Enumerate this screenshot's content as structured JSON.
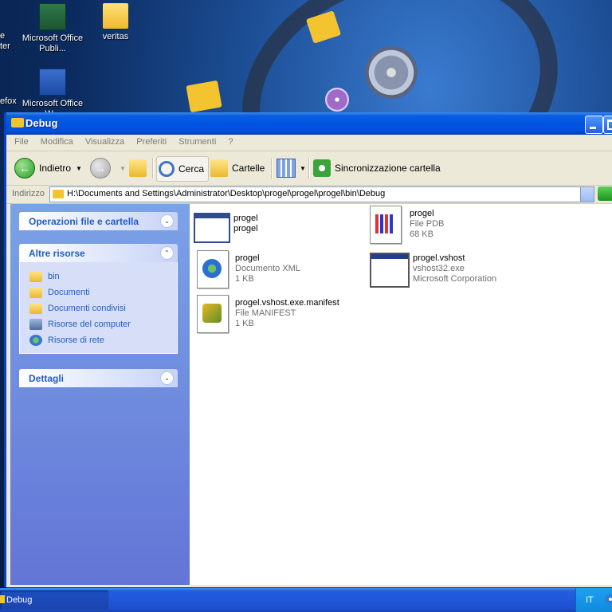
{
  "desktop": {
    "icons": [
      {
        "name": "publisher-shortcut",
        "label": "Microsoft Office Publi..."
      },
      {
        "name": "veritas-folder",
        "label": "veritas"
      },
      {
        "name": "word-shortcut",
        "label": "Microsoft Office W..."
      }
    ],
    "edge_labels": [
      "e",
      "ter",
      "efox"
    ]
  },
  "window": {
    "title": "Debug",
    "menu": [
      "File",
      "Modifica",
      "Visualizza",
      "Preferiti",
      "Strumenti",
      "?"
    ],
    "toolbar": {
      "back": "Indietro",
      "search": "Cerca",
      "folders": "Cartelle",
      "sync": "Sincronizzazione cartella"
    },
    "address": {
      "label": "Indirizzo",
      "path": "H:\\Documents and Settings\\Administrator\\Desktop\\progel\\progel\\progel\\bin\\Debug"
    },
    "taskpane": {
      "panel1": {
        "title": "Operazioni file e cartella"
      },
      "panel2": {
        "title": "Altre risorse",
        "items": [
          {
            "label": "bin",
            "icon": "folder-icon"
          },
          {
            "label": "Documenti",
            "icon": "folder-icon"
          },
          {
            "label": "Documenti condivisi",
            "icon": "folder-icon"
          },
          {
            "label": "Risorse del computer",
            "icon": "computer-icon"
          },
          {
            "label": "Risorse di rete",
            "icon": "network-icon"
          }
        ]
      },
      "panel3": {
        "title": "Dettagli"
      }
    },
    "files": [
      {
        "name": "progel",
        "line2": "progel",
        "line3": ""
      },
      {
        "name": "progel",
        "line2": "File PDB",
        "line3": "68 KB"
      },
      {
        "name": "progel",
        "line2": "Documento XML",
        "line3": "1 KB"
      },
      {
        "name": "progel.vshost",
        "line2": "vshost32.exe",
        "line3": "Microsoft Corporation"
      },
      {
        "name": "progel.vshost.exe.manifest",
        "line2": "File MANIFEST",
        "line3": "1 KB"
      }
    ]
  },
  "taskbar": {
    "task_label": "Debug",
    "language": "IT"
  }
}
